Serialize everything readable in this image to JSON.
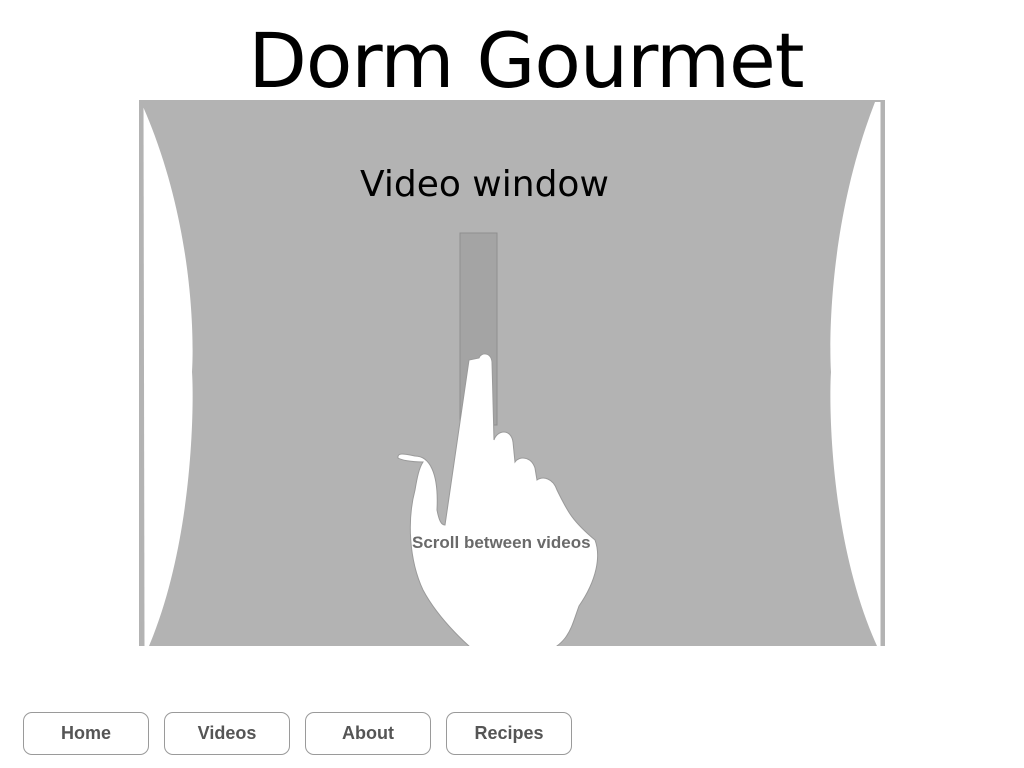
{
  "header": {
    "title": "Dorm Gourmet"
  },
  "video": {
    "label": "Video window",
    "scroll_hint": "Scroll between videos",
    "scroll_icon": "hand-swipe-icon"
  },
  "nav": {
    "items": [
      {
        "label": "Home"
      },
      {
        "label": "Videos"
      },
      {
        "label": "About"
      },
      {
        "label": "Recipes"
      }
    ]
  },
  "colors": {
    "video_fill": "#b3b3b3",
    "scroll_track": "#a4a4a4",
    "button_text": "#555555",
    "button_border": "#9a9a9a"
  }
}
